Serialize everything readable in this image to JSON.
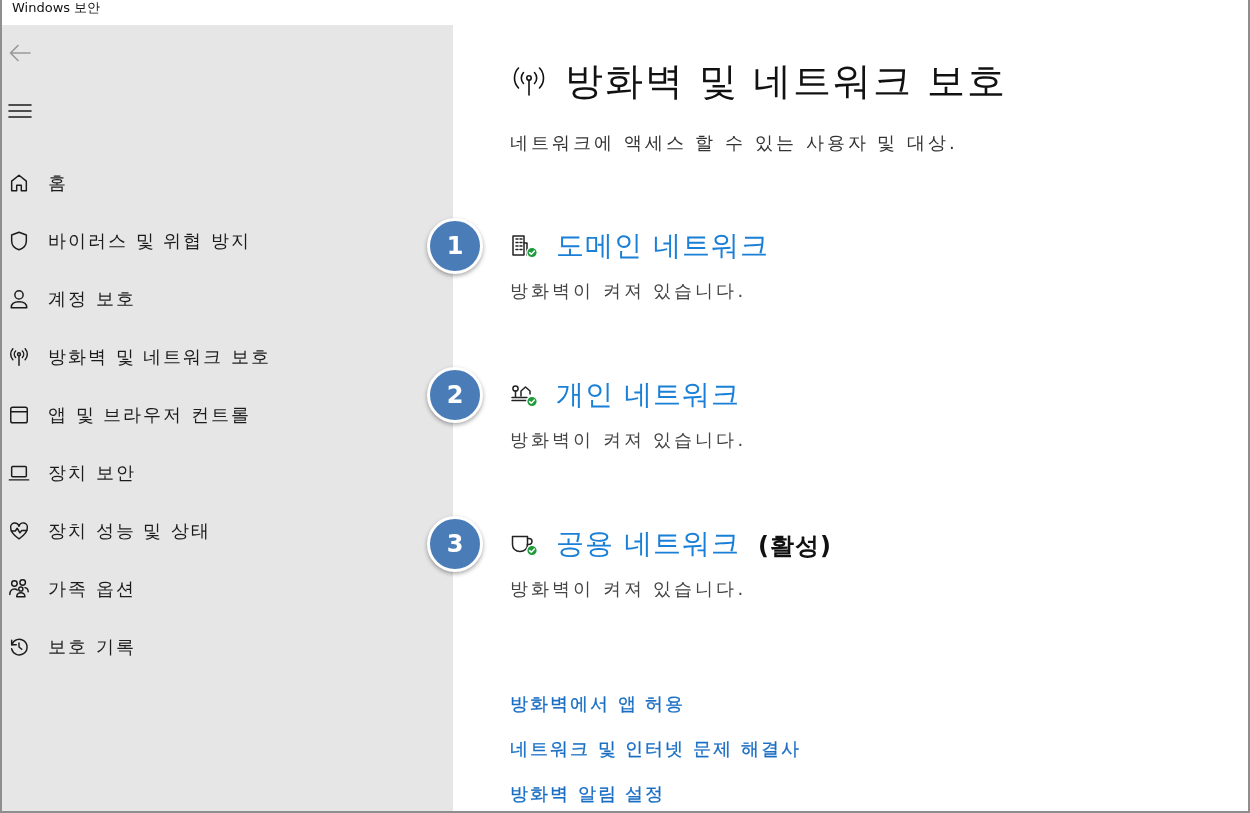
{
  "window": {
    "title": "Windows 보안"
  },
  "sidebar": {
    "back_button": {
      "disabled": true
    },
    "items": [
      {
        "kind": "home",
        "label": "홈"
      },
      {
        "kind": "shield",
        "label": "바이러스 및 위협 방지"
      },
      {
        "kind": "account",
        "label": "계정 보호"
      },
      {
        "kind": "antenna",
        "label": "방화벽 및 네트워크 보호"
      },
      {
        "kind": "browser",
        "label": "앱 및 브라우저 컨트롤"
      },
      {
        "kind": "laptop",
        "label": "장치 보안"
      },
      {
        "kind": "health",
        "label": "장치 성능 및 상태"
      },
      {
        "kind": "family",
        "label": "가족 옵션"
      },
      {
        "kind": "history",
        "label": "보호 기록"
      }
    ]
  },
  "page": {
    "title": "방화벽 및 네트워크 보호",
    "subtitle": "네트워크에 액세스 할 수 있는 사용자 및 대상."
  },
  "networks": [
    {
      "badge": "1",
      "kind": "domain",
      "name": "도메인 네트워크",
      "firewall_on": true,
      "status": "방화벽이 켜져 있습니다."
    },
    {
      "badge": "2",
      "kind": "private",
      "name": "개인 네트워크",
      "firewall_on": true,
      "status": "방화벽이 켜져 있습니다."
    },
    {
      "badge": "3",
      "kind": "public",
      "name": "공용 네트워크",
      "tag": "(활성)",
      "firewall_on": true,
      "status": "방화벽이 켜져 있습니다."
    }
  ],
  "links": [
    "방화벽에서 앱 허용",
    "네트워크 및 인터넷 문제 해결사",
    "방화벽 알림 설정"
  ]
}
